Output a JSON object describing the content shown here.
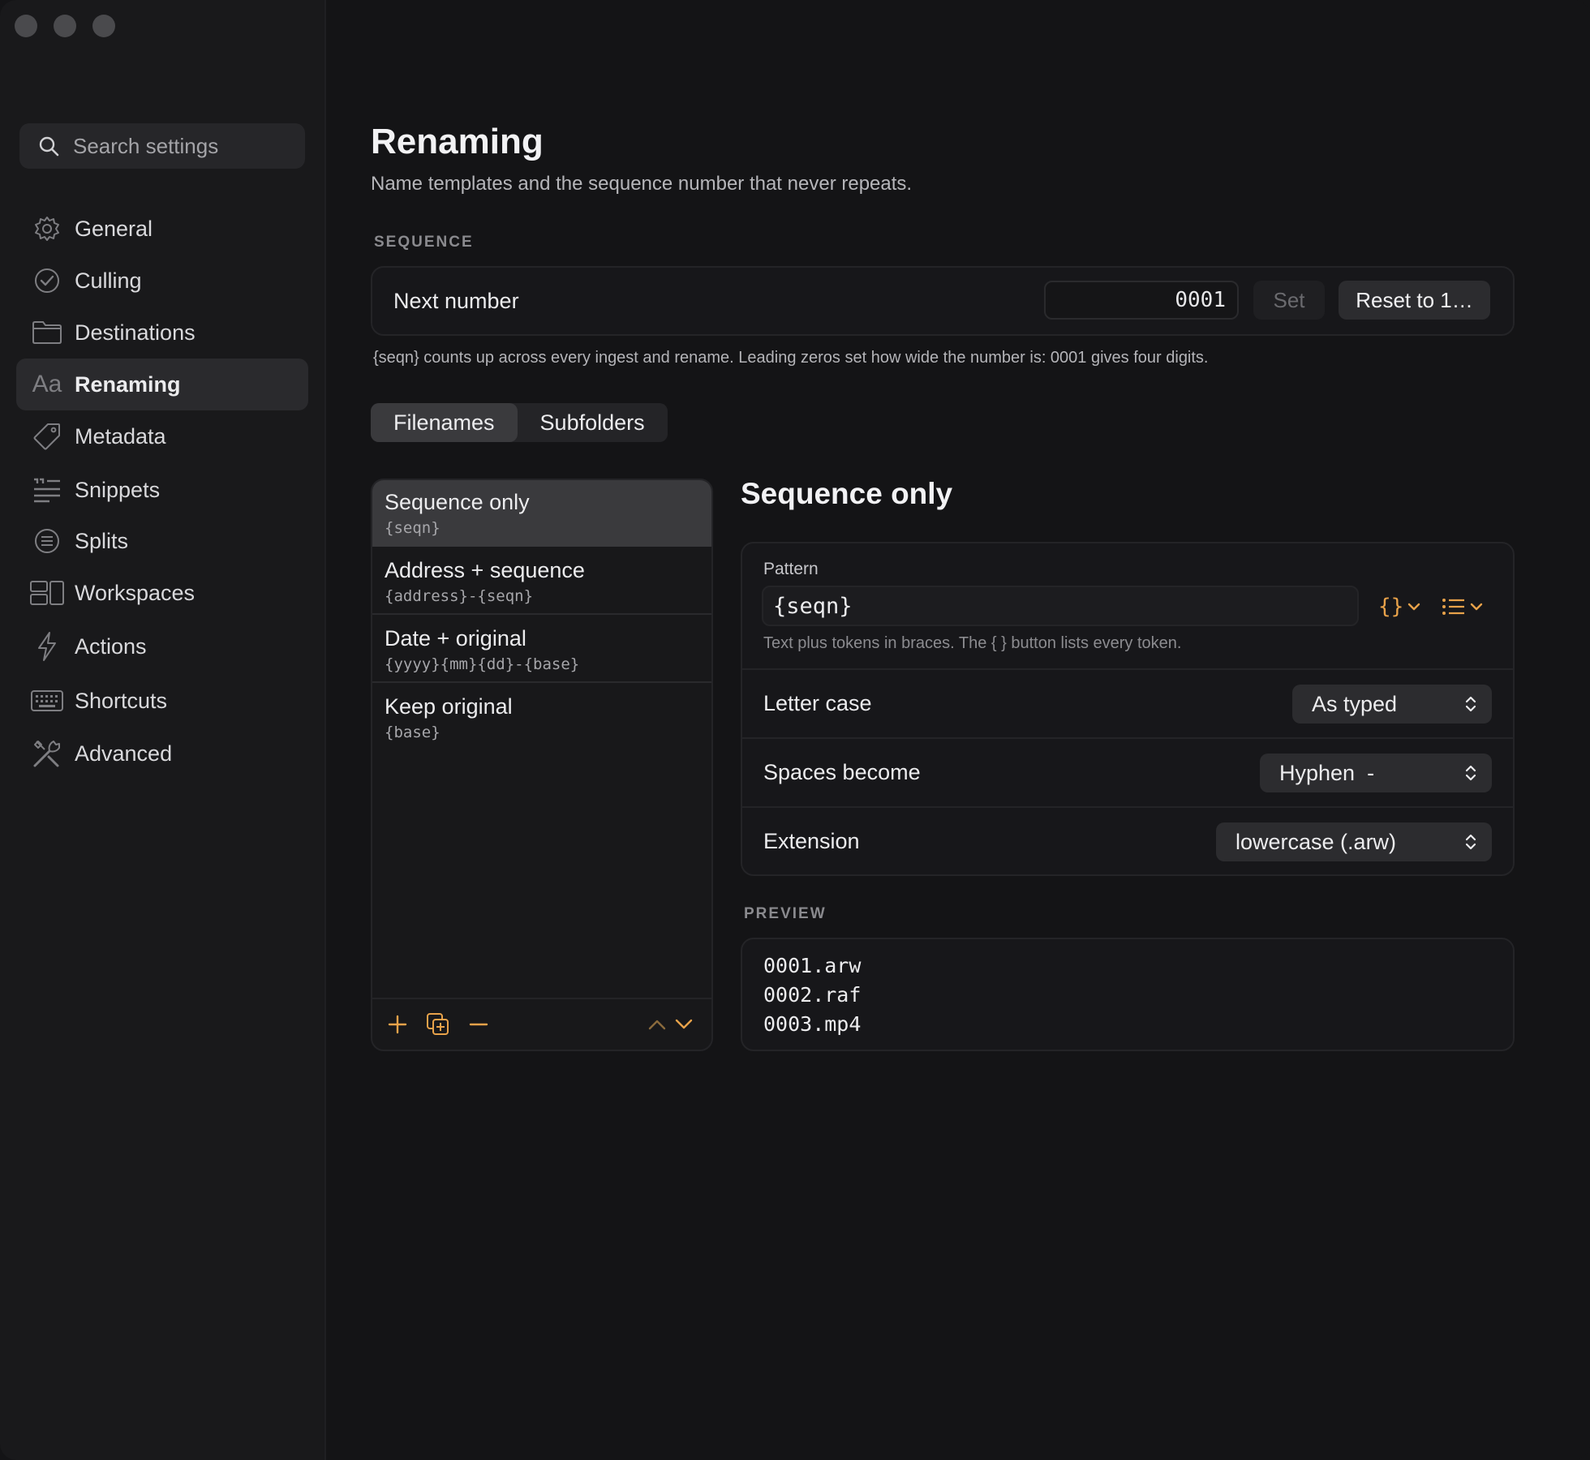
{
  "sidebar": {
    "search_placeholder": "Search settings",
    "items": [
      {
        "label": "General",
        "icon": "gear-icon"
      },
      {
        "label": "Culling",
        "icon": "checkmark-circle-icon"
      },
      {
        "label": "Destinations",
        "icon": "folder-icon"
      },
      {
        "label": "Renaming",
        "icon": "text-aa-icon",
        "active": true
      },
      {
        "label": "Metadata",
        "icon": "tag-icon"
      },
      {
        "label": "Snippets",
        "icon": "text-snippet-icon"
      },
      {
        "label": "Splits",
        "icon": "list-circle-icon"
      },
      {
        "label": "Workspaces",
        "icon": "layout-icon"
      },
      {
        "label": "Actions",
        "icon": "bolt-icon"
      },
      {
        "label": "Shortcuts",
        "icon": "keyboard-icon"
      },
      {
        "label": "Advanced",
        "icon": "tools-icon"
      }
    ],
    "aa_glyph": "Aa"
  },
  "page": {
    "title": "Renaming",
    "subtitle": "Name templates and the sequence number that never repeats."
  },
  "sequence": {
    "section_label": "SEQUENCE",
    "label": "Next number",
    "value": "0001",
    "set_label": "Set",
    "reset_label": "Reset to 1…",
    "help": "{seqn} counts up across every ingest and rename. Leading zeros set how wide the number is: 0001 gives four digits."
  },
  "tabs": {
    "items": [
      {
        "label": "Filenames",
        "active": true
      },
      {
        "label": "Subfolders",
        "active": false
      }
    ]
  },
  "templates": [
    {
      "name": "Sequence only",
      "pattern": "{seqn}",
      "selected": true
    },
    {
      "name": "Address + sequence",
      "pattern": "{address}-{seqn}"
    },
    {
      "name": "Date + original",
      "pattern": "{yyyy}{mm}{dd}-{base}"
    },
    {
      "name": "Keep original",
      "pattern": "{base}"
    }
  ],
  "detail": {
    "title": "Sequence only",
    "pattern_label": "Pattern",
    "pattern_value": "{seqn}",
    "token_glyph": "{}",
    "pattern_help": "Text plus tokens in braces. The { } button lists every token.",
    "letter_case_label": "Letter case",
    "letter_case_value": "As typed",
    "spaces_label": "Spaces become",
    "spaces_value": "Hyphen  -",
    "extension_label": "Extension",
    "extension_value": "lowercase (.arw)"
  },
  "preview": {
    "section_label": "PREVIEW",
    "lines": [
      "0001.arw",
      "0002.raf",
      "0003.mp4"
    ]
  },
  "colors": {
    "accent": "#e8a24a",
    "background": "#141416",
    "sidebar": "#19191b"
  }
}
